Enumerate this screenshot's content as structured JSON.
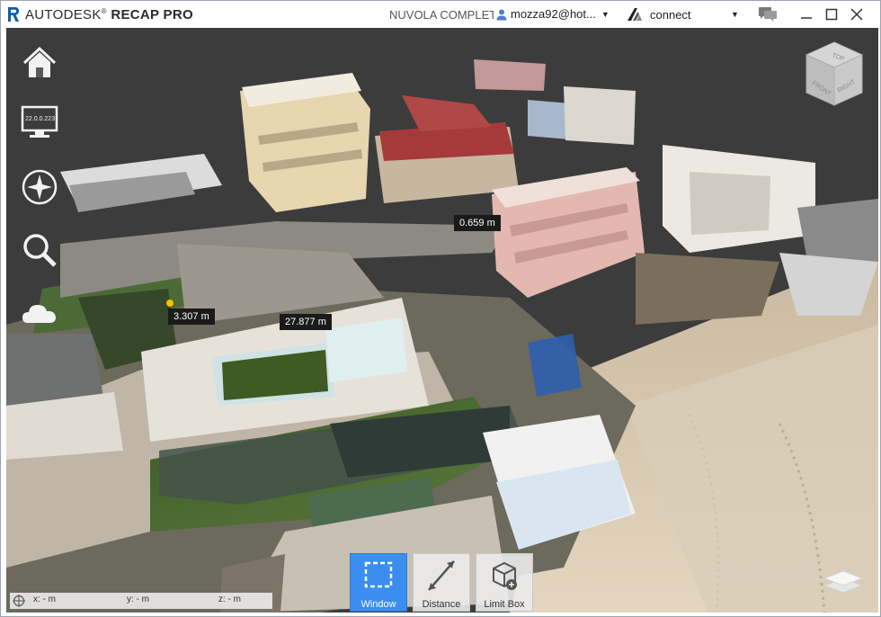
{
  "titlebar": {
    "brand_light": "AUTODESK",
    "brand_reg": "®",
    "brand_bold": "RECAP PRO",
    "project": "NUVOLA COMPLETA",
    "user": "mozza92@hot...",
    "connect": "connect"
  },
  "viewport": {
    "camera_label": "22.0.0.223",
    "measurements": [
      {
        "label": "0.659 m"
      },
      {
        "label": "3.307 m"
      },
      {
        "label": "27.877 m"
      }
    ],
    "navcube": {
      "top": "TOP",
      "front": "FRONT",
      "right": "RIGHT"
    }
  },
  "toolbar": {
    "window_label": "Window",
    "distance_label": "Distance",
    "limitbox_label": "Limit Box"
  },
  "coordinates": {
    "x": "x:  -  m",
    "y": "y:  -  m",
    "z": "z:  -  m"
  },
  "colors": {
    "accent": "#3b8ef0",
    "viewport_bg": "#3a3a3a",
    "measure_bg": "#1a1a1a"
  }
}
